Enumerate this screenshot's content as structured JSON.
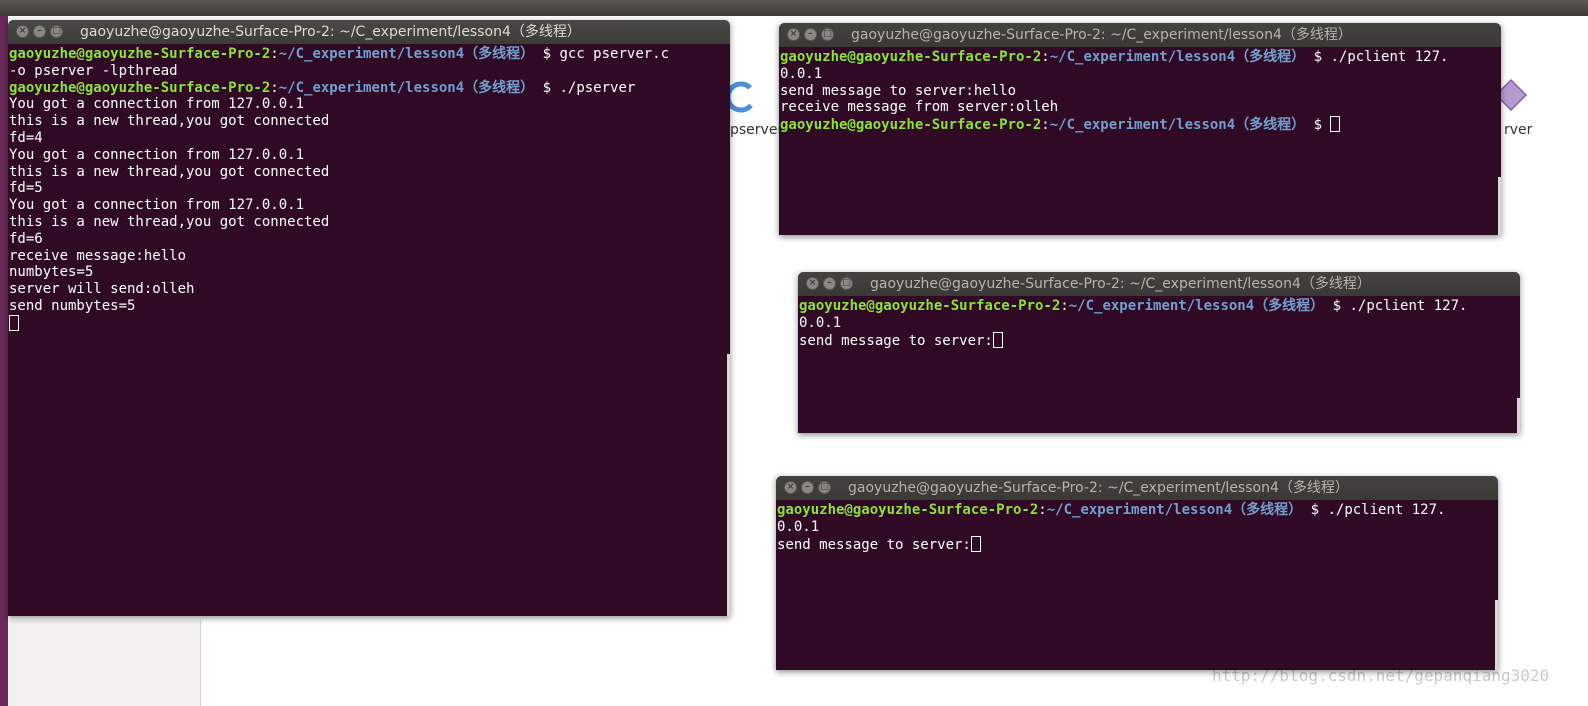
{
  "desktop": {
    "icons": [
      {
        "label": "pserver",
        "icon": "c-source-icon"
      },
      {
        "label": "rver",
        "icon": "executable-icon"
      }
    ],
    "watermark": "http://blog.csdn.net/gepanqiang3020"
  },
  "prompt": {
    "user_host": "gaoyuzhe@gaoyuzhe-Surface-Pro-2",
    "sep": ":",
    "path": "~/C_experiment/lesson4（多线程）",
    "dollar": " $ "
  },
  "server_window": {
    "title": "gaoyuzhe@gaoyuzhe-Surface-Pro-2: ~/C_experiment/lesson4（多线程）",
    "cmd1_a": "gcc pserver.c",
    "cmd1_b": "-o pserver -lpthread",
    "cmd2": "./pserver",
    "output": [
      "You got a connection from 127.0.0.1",
      "this is a new thread,you got connected",
      "fd=4",
      "You got a connection from 127.0.0.1",
      "this is a new thread,you got connected",
      "fd=5",
      "You got a connection from 127.0.0.1",
      "this is a new thread,you got connected",
      "fd=6",
      "receive message:hello",
      "numbytes=5",
      "server will send:olleh",
      "send numbytes=5"
    ]
  },
  "client_windows": [
    {
      "title": "gaoyuzhe@gaoyuzhe-Surface-Pro-2: ~/C_experiment/lesson4（多线程）",
      "cmd_a": "./pclient 127.",
      "cmd_b": "0.0.1",
      "output": [
        "send message to server:hello",
        "receive message from server:olleh"
      ]
    },
    {
      "title": "gaoyuzhe@gaoyuzhe-Surface-Pro-2: ~/C_experiment/lesson4（多线程）",
      "cmd_a": "./pclient 127.",
      "cmd_b": "0.0.1",
      "output_prompt": "send message to server:"
    },
    {
      "title": "gaoyuzhe@gaoyuzhe-Surface-Pro-2: ~/C_experiment/lesson4（多线程）",
      "cmd_a": "./pclient 127.",
      "cmd_b": "0.0.1",
      "output_prompt": "send message to server:"
    }
  ],
  "window_buttons": {
    "close": "×",
    "minimize": "–",
    "maximize": "□"
  },
  "colors": {
    "terminal_bg": "#300a24",
    "user_host": "#8ae234",
    "path": "#729fcf",
    "titlebar": "#3c3b37"
  }
}
